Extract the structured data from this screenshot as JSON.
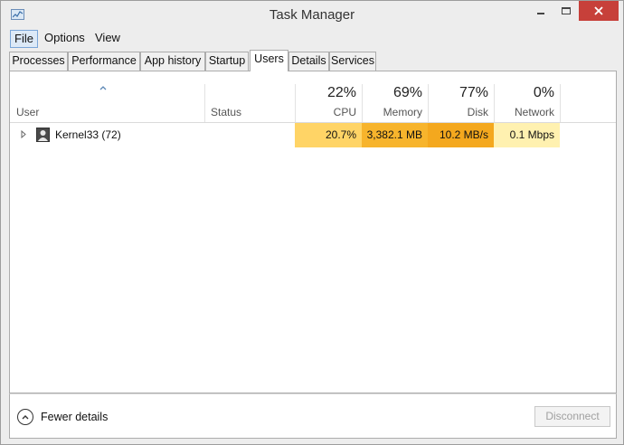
{
  "window": {
    "title": "Task Manager"
  },
  "menu": [
    {
      "label": "File",
      "active": true
    },
    {
      "label": "Options",
      "active": false
    },
    {
      "label": "View",
      "active": false
    }
  ],
  "tabs": [
    {
      "label": "Processes"
    },
    {
      "label": "Performance"
    },
    {
      "label": "App history"
    },
    {
      "label": "Startup"
    },
    {
      "label": "Users",
      "selected": true
    },
    {
      "label": "Details"
    },
    {
      "label": "Services"
    }
  ],
  "columns": {
    "user": {
      "label": "User"
    },
    "status": {
      "label": "Status"
    },
    "cpu": {
      "label": "CPU",
      "percent": "22%"
    },
    "memory": {
      "label": "Memory",
      "percent": "69%"
    },
    "disk": {
      "label": "Disk",
      "percent": "77%"
    },
    "network": {
      "label": "Network",
      "percent": "0%"
    }
  },
  "rows": [
    {
      "user": "Kernel33 (72)",
      "status": "",
      "cpu": "20.7%",
      "memory": "3,382.1 MB",
      "disk": "10.2 MB/s",
      "network": "0.1 Mbps"
    }
  ],
  "heat_colors": {
    "cpu": "#ffd466",
    "memory": "#f7b42c",
    "disk": "#f4a81e",
    "network": "#fff1b0"
  },
  "footer": {
    "fewer_details": "Fewer details",
    "disconnect": "Disconnect"
  },
  "icons": {
    "app": "task-manager-icon",
    "expand": "expand-arrow-icon",
    "user": "user-avatar-icon",
    "sort": "sort-up-icon",
    "fewer": "chevron-up-circle-icon"
  }
}
